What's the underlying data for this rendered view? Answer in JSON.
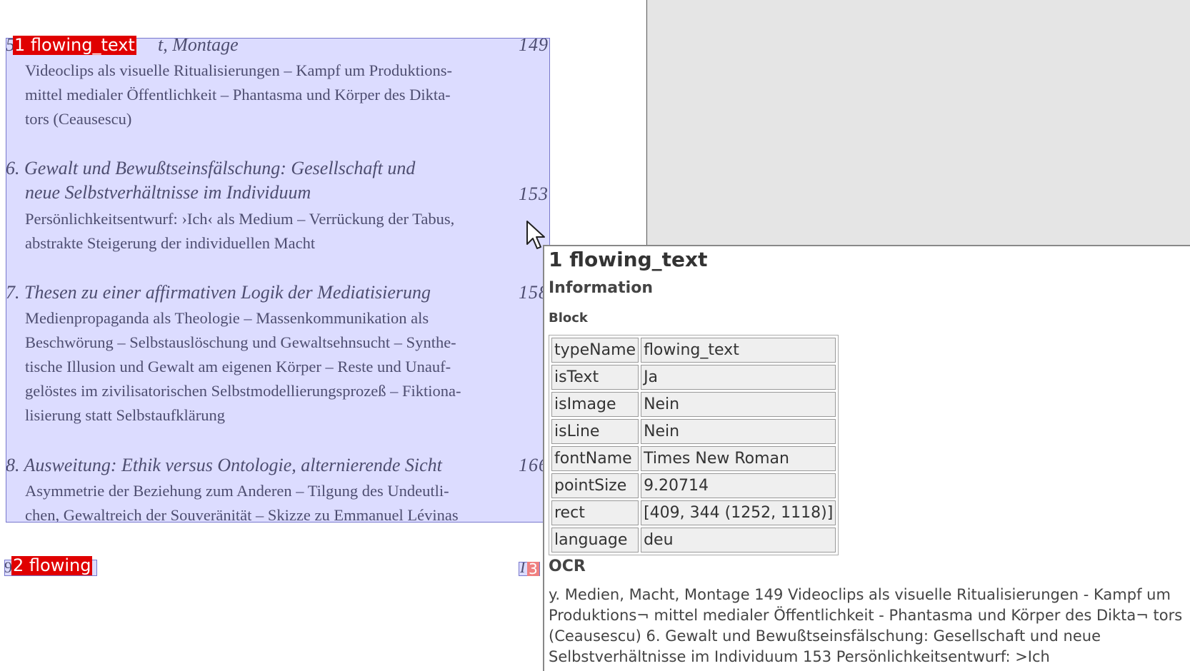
{
  "page": {
    "entries": [
      {
        "title": "5. Medien, Macht, Montage",
        "title_visible": "t, Montage",
        "page": "149",
        "desc_lines": [
          "Videoclips als visuelle Ritualisierungen – Kampf um Produktions-",
          "mittel medialer Öffentlichkeit – Phantasma und Körper des Dikta-",
          "tors (Ceausescu)"
        ]
      },
      {
        "title_lines": [
          "6. Gewalt und Bewußtseinsfälschung: Gesellschaft und",
          "neue Selbstverhältnisse im Individuum"
        ],
        "page": "153",
        "desc_lines": [
          "Persönlichkeitsentwurf: ›Ich‹ als Medium – Verrückung der Tabus,",
          "abstrakte Steigerung der individuellen Macht"
        ]
      },
      {
        "title": "7. Thesen zu einer affirmativen Logik der Mediatisierung",
        "page": "158",
        "desc_lines": [
          "Medienpropaganda als Theologie – Massenkommunikation als",
          "Beschwörung – Selbstauslöschung und Gewaltsehnsucht – Synthe-",
          "tische Illusion und Gewalt am eigenen Körper – Reste und Unauf-",
          "gelöstes im zivilisatorischen Selbstmodellierungsprozeß – Fiktiona-",
          "lisierung statt Selbstaufklärung"
        ]
      },
      {
        "title": "8. Ausweitung: Ethik versus Ontologie, alternierende Sicht",
        "page": "166",
        "desc_lines": [
          "Asymmetrie der Beziehung zum Anderen – Tilgung des Undeutli-",
          "chen, Gewaltreich der Souveränität – Skizze zu Emmanuel Lévinas"
        ]
      }
    ],
    "footer_left": "9",
    "footer_right": "I"
  },
  "labels": {
    "block1": "1 flowing_text",
    "block2": "2 flowing",
    "block3": "3"
  },
  "popup": {
    "title": "1 flowing_text",
    "section": "Information",
    "subsection": "Block",
    "rows": [
      {
        "key": "typeName",
        "value": "flowing_text"
      },
      {
        "key": "isText",
        "value": "Ja"
      },
      {
        "key": "isImage",
        "value": "Nein"
      },
      {
        "key": "isLine",
        "value": "Nein"
      },
      {
        "key": "fontName",
        "value": "Times New Roman"
      },
      {
        "key": "pointSize",
        "value": "9.20714"
      },
      {
        "key": "rect",
        "value": "[409, 344 (1252, 1118)]"
      },
      {
        "key": "language",
        "value": "deu"
      }
    ],
    "ocr_heading": "OCR",
    "ocr_text": "y. Medien, Macht, Montage 149 Videoclips als visuelle Ritualisierungen - Kampf um Produktions¬ mittel medialer Öffentlichkeit - Phantasma und Körper des Dikta¬ tors (Ceausescu) 6. Gewalt und Bewußtseinsfälschung: Gesellschaft und neue Selbstverhältnisse im Individuum 153 Persönlichkeitsentwurf: >Ich"
  },
  "colors": {
    "block_overlay": "#9696ff",
    "label_red": "#e00000",
    "panel_gray": "#e5e5e5"
  },
  "icons": {
    "cursor": "mouse-pointer-icon"
  }
}
